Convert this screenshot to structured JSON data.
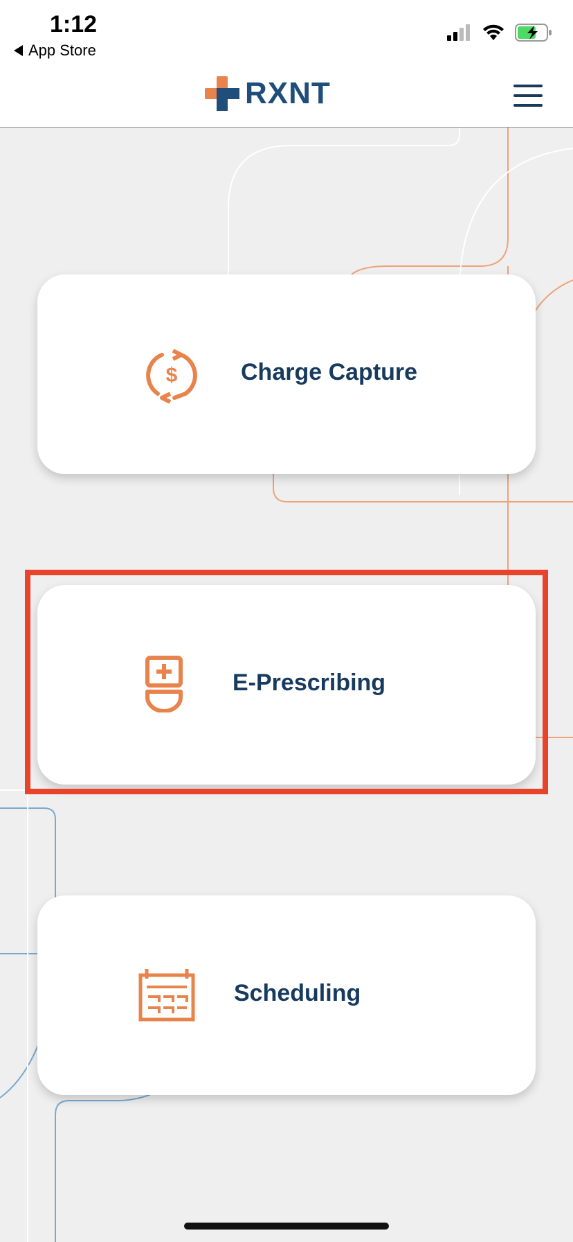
{
  "status_bar": {
    "time": "1:12",
    "back_app": "App Store",
    "icons": [
      "signal-icon",
      "wifi-icon",
      "battery-charging-icon"
    ]
  },
  "header": {
    "logo_text": "RXNT",
    "icons": [
      "rxnt-logo-icon",
      "hamburger-menu-icon"
    ]
  },
  "cards": [
    {
      "label": "Charge Capture",
      "icon": "charge-capture-icon"
    },
    {
      "label": "E-Prescribing",
      "icon": "prescription-icon"
    },
    {
      "label": "Scheduling",
      "icon": "calendar-icon"
    }
  ],
  "colors": {
    "accent_orange": "#e8834b",
    "brand_navy": "#173a5e",
    "logo_blue": "#1f4e7a",
    "highlight_red": "#e8442b",
    "background": "#efefef"
  }
}
